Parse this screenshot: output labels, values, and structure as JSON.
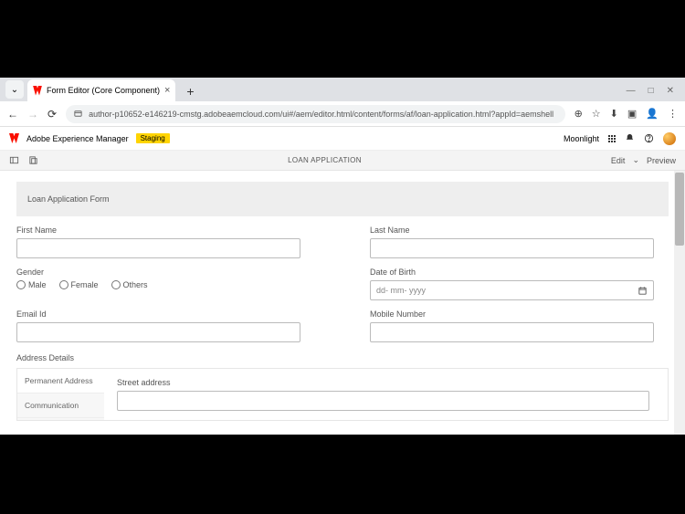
{
  "browser": {
    "tab_title": "Form Editor (Core Component)",
    "url": "author-p10652-e146219-cmstg.adobeaemcloud.com/ui#/aem/editor.html/content/forms/af/loan-application.html?appId=aemshell",
    "newtab": "+",
    "close": "×",
    "chevron": "⌄",
    "min": "—",
    "max": "□",
    "x": "✕",
    "back": "←",
    "fwd": "→",
    "reload": "⟳",
    "zoom": "⊕",
    "star": "☆",
    "dl": "⬇",
    "ext": "▣",
    "user": "👤",
    "menu": "⋮"
  },
  "aem": {
    "product": "Adobe Experience Manager",
    "badge": "Staging",
    "tenant": "Moonlight",
    "bell": "🔔",
    "help": "❔"
  },
  "editbar": {
    "title": "LOAN APPLICATION",
    "edit": "Edit",
    "chev": "⌄",
    "preview": "Preview"
  },
  "form": {
    "header": "Loan Application Form",
    "first_name": "First Name",
    "last_name": "Last Name",
    "gender": "Gender",
    "g_male": "Male",
    "g_female": "Female",
    "g_others": "Others",
    "dob": "Date of Birth",
    "dob_ph": "dd- mm- yyyy",
    "email": "Email Id",
    "mobile": "Mobile Number",
    "address_section": "Address Details",
    "tab_perm": "Permanent Address",
    "tab_comm": "Communication",
    "street": "Street address"
  }
}
